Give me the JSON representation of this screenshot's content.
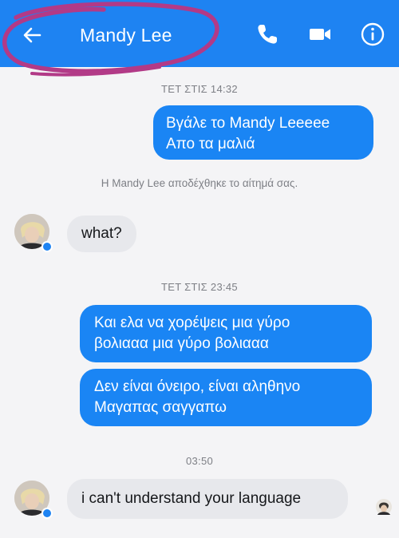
{
  "header": {
    "contact_name": "Mandy Lee",
    "icons": [
      "back-arrow-icon",
      "phone-icon",
      "video-icon",
      "info-icon"
    ],
    "background_color": "#1e83f2",
    "highlight_color": "#b23a87"
  },
  "messages": {
    "ts1": "ΤΕΤ ΣΤΙΣ 14:32",
    "m1_line1": "Βγάλε το Mandy Leeeee",
    "m1_line2": "Απο τα μαλιά",
    "system_note": "Η Mandy Lee αποδέχθηκε το αίτημά σας.",
    "m2": "what?",
    "ts2": "ΤΕΤ ΣΤΙΣ 23:45",
    "m3_line1": "Και ελα να χορέψεις μια γύρο",
    "m3_line2": "βολιααα μια γύρο βολιααα",
    "m4_line1": "Δεν είναι όνειρο, είναι αληθηνο",
    "m4_line2": "Μαγαπας σαγγαπω",
    "ts3": "03:50",
    "m5": "i can't understand your language"
  },
  "colors": {
    "outgoing_bubble": "#1a85f4",
    "incoming_bubble": "#e7e8ec",
    "timestamp_text": "#7d7f85"
  }
}
